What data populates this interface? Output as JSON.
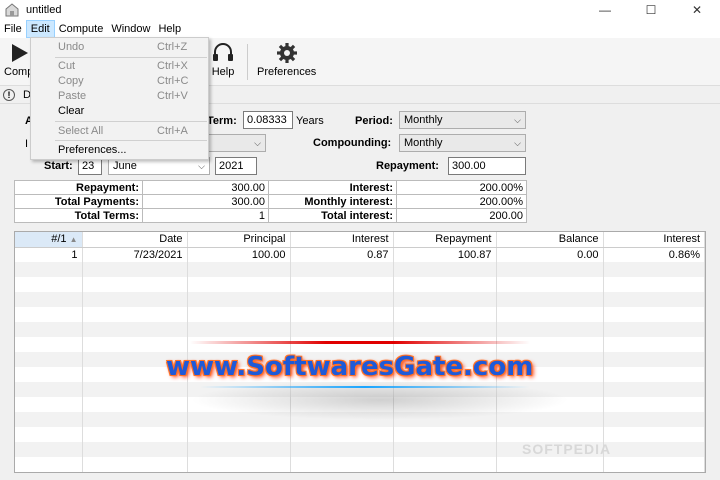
{
  "window": {
    "title": "untitled",
    "minimize": "—",
    "maximize": "☐",
    "close": "✕"
  },
  "menubar": [
    "File",
    "Edit",
    "Compute",
    "Window",
    "Help"
  ],
  "toolbar": {
    "compute_label": "Comp",
    "help_label": "Help",
    "preferences_label": "Preferences"
  },
  "infobar": {
    "text": "D"
  },
  "form": {
    "row1_partial_label": "A",
    "term_label": "Term:",
    "term_value": "0.08333",
    "term_unit": "Years",
    "period_label": "Period:",
    "period_value": "Monthly",
    "row2_partial_label": "I",
    "compounding_label": "Compounding:",
    "compounding_value": "Monthly",
    "start_label": "Start:",
    "start_day": "23",
    "start_month": "June",
    "start_year": "2021",
    "repayment_label": "Repayment:",
    "repayment_value": "300.00"
  },
  "summary": [
    {
      "k1": "Repayment:",
      "v1": "300.00",
      "k2": "Interest:",
      "v2": "200.00%"
    },
    {
      "k1": "Total Payments:",
      "v1": "300.00",
      "k2": "Monthly interest:",
      "v2": "200.00%"
    },
    {
      "k1": "Total Terms:",
      "v1": "1",
      "k2": "Total interest:",
      "v2": "200.00"
    }
  ],
  "grid": {
    "columns": [
      "#/1",
      "Date",
      "Principal",
      "Interest",
      "Repayment",
      "Balance",
      "Interest"
    ],
    "sort_indicator": "▲",
    "rows": [
      [
        "1",
        "7/23/2021",
        "100.00",
        "0.87",
        "100.87",
        "0.00",
        "0.86%"
      ]
    ]
  },
  "edit_menu": [
    {
      "label": "Undo",
      "shortcut": "Ctrl+Z",
      "enabled": false
    },
    {
      "label": "Cut",
      "shortcut": "Ctrl+X",
      "enabled": false
    },
    {
      "label": "Copy",
      "shortcut": "Ctrl+C",
      "enabled": false
    },
    {
      "label": "Paste",
      "shortcut": "Ctrl+V",
      "enabled": false
    },
    {
      "label": "Clear",
      "shortcut": "",
      "enabled": true
    },
    {
      "label": "Select All",
      "shortcut": "Ctrl+A",
      "enabled": false
    },
    {
      "label": "Preferences...",
      "shortcut": "",
      "enabled": true
    }
  ],
  "watermark": {
    "text": "www.SoftwaresGate.com",
    "softpedia": "SOFTPEDIA"
  },
  "colors": {
    "menu_active_bg": "#cce8ff",
    "grid_header_selected": "#dbe9f7",
    "watermark_blue": "#1e5ad8",
    "watermark_orange": "#ff7a2a"
  }
}
